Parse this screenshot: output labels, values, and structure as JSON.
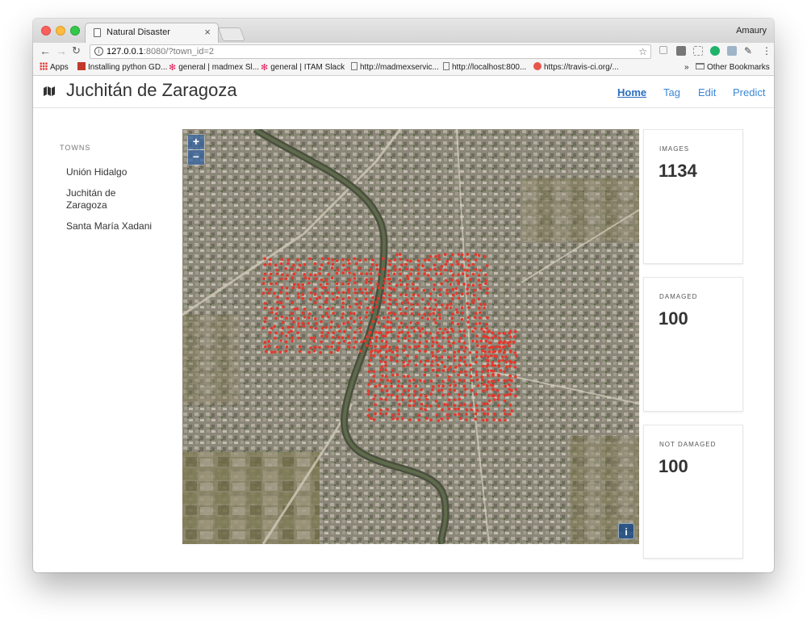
{
  "browser": {
    "tab_title": "Natural Disaster",
    "tab_close": "×",
    "profile_name": "Amaury",
    "url_host": "127.0.0.1",
    "url_path": ":8080/?town_id=2",
    "bookmarks": [
      "Apps",
      "Installing python GD...",
      "general | madmex Sl...",
      "general | ITAM Slack",
      "http://madmexservic...",
      "http://localhost:800...",
      "https://travis-ci.org/..."
    ],
    "overflow": "»",
    "other_bookmarks": "Other Bookmarks"
  },
  "header": {
    "title": "Juchitán de Zaragoza",
    "nav": [
      "Home",
      "Tag",
      "Edit",
      "Predict"
    ],
    "active_nav": "Home"
  },
  "sidebar": {
    "heading": "TOWNS",
    "towns": [
      "Unión Hidalgo",
      "Juchitán de Zaragoza",
      "Santa María Xadani"
    ]
  },
  "map": {
    "zoom_in": "+",
    "zoom_out": "−",
    "info": "i",
    "marker_color": "#e8362b"
  },
  "stats": [
    {
      "label": "IMAGES",
      "value": "1134"
    },
    {
      "label": "DAMAGED",
      "value": "100"
    },
    {
      "label": "NOT DAMAGED",
      "value": "100"
    }
  ],
  "colors": {
    "link": "#3a87d6",
    "title": "#333333"
  }
}
